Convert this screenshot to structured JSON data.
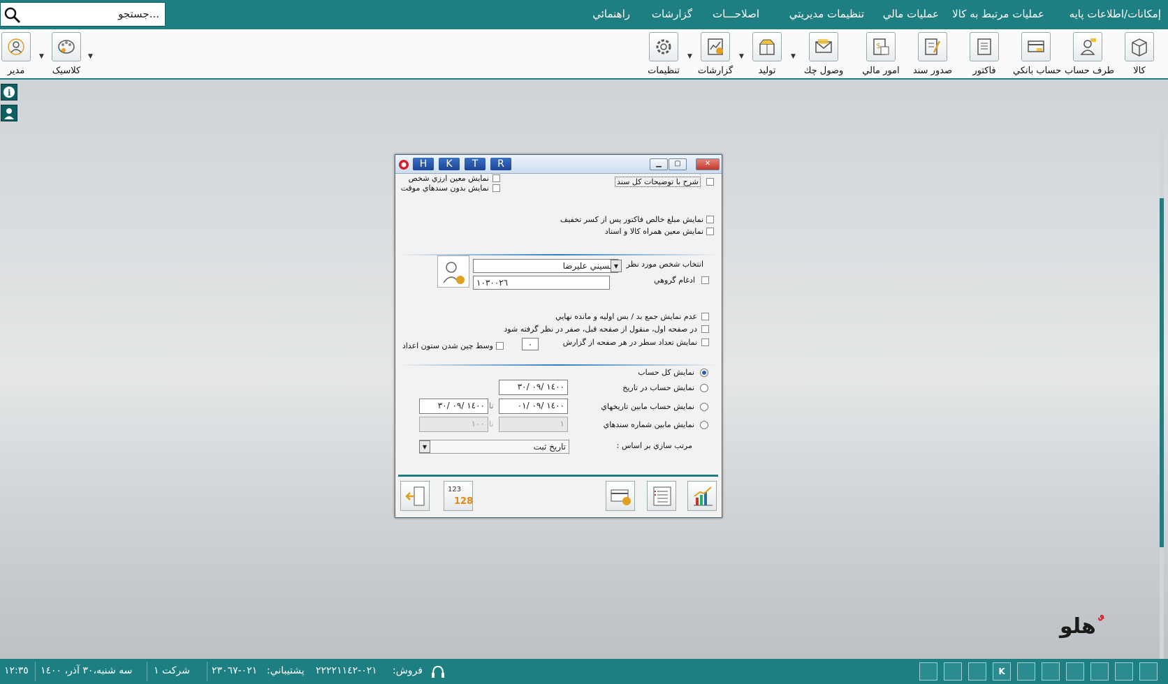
{
  "menubar": {
    "search_placeholder": "جستجو...",
    "items": [
      "إمكانات/اطلاعات پايه",
      "عمليات مرتبط به كالا",
      "عمليات مالي",
      "تنظيمات مديريتي",
      "اصلاحـــات",
      "گزارشات",
      "راهنمائي"
    ]
  },
  "toolbar": {
    "right_items": [
      "كالا",
      "طرف حساب",
      "حساب بانكي",
      "فاكتور",
      "صدور سند",
      "امور مالي",
      "وصول چك",
      "توليد",
      "گزارشات",
      "تنظيمات"
    ],
    "left_items": [
      "كلاسيک",
      "مدير"
    ]
  },
  "dialog": {
    "hotkeys": [
      "H",
      "K",
      "T",
      "R"
    ],
    "checks": {
      "sharh": "شرح با توضيحات كل سند",
      "moein_arzi": "نمايش معين ارزي شخص",
      "bedoon_movaghat": "نمايش بدون سندهاي موقت",
      "khales": "نمايش مبلغ خالص فاكتور پس از كسر تخفيف",
      "moein_kala": "نمايش معين همراه كالا و اسناد",
      "adgham": "ادغام گروهي",
      "adam_jam": "عدم نمايش جمع بد / بس اوليه و مانده نهايي",
      "safhe_aval": "در صفحه اول، منقول از صفحه قبل، صفر در نظر گرفته شود",
      "tedad_satr": "نمايش تعداد سطر در هر صفحه از گزارش",
      "vasat_chin": "وسط چين شدن ستون اعداد"
    },
    "person_label": "انتخاب شخص مورد نظر",
    "person_value": "حسيني عليرضا",
    "person_code": "١٠٣٠٠٢٦",
    "rows_per_page": "٠",
    "radios": {
      "kol": "نمايش كل حساب",
      "dar_tarikh": "نمايش حساب در تاريخ",
      "mabeyn_tarikh": "نمايش حساب مابين تاريخهاي",
      "mabeyn_shomare": "نمايش مابين شماره سندهاي"
    },
    "date_at": "١٤٠٠ /٠٩ /٣٠",
    "date_from": "١٤٠٠ /٠٩ /٠١",
    "date_to": "١٤٠٠ /٠٩ /٣٠",
    "to_word": "تا",
    "doc_from": "١",
    "doc_to": "١٠٠",
    "sort_label": "مرتب سازي بر اساس :",
    "sort_value": "تاريخ ثبت",
    "numfmt_top": "123",
    "numfmt_bottom": "128"
  },
  "statusbar": {
    "datetime": "سه شنبه،٣٠ آذر، ١٤٠٠",
    "time": "١٢:٣٥",
    "company": "شركت ١",
    "sales_label": "فروش:",
    "sales_phone": "٠٢١-٢٢٢٢١١٤٢",
    "support_label": "پشتيباني:",
    "support_phone": "٠٢١-٢٣٠٦٧"
  },
  "brand": {
    "logo_text": "هلو"
  }
}
